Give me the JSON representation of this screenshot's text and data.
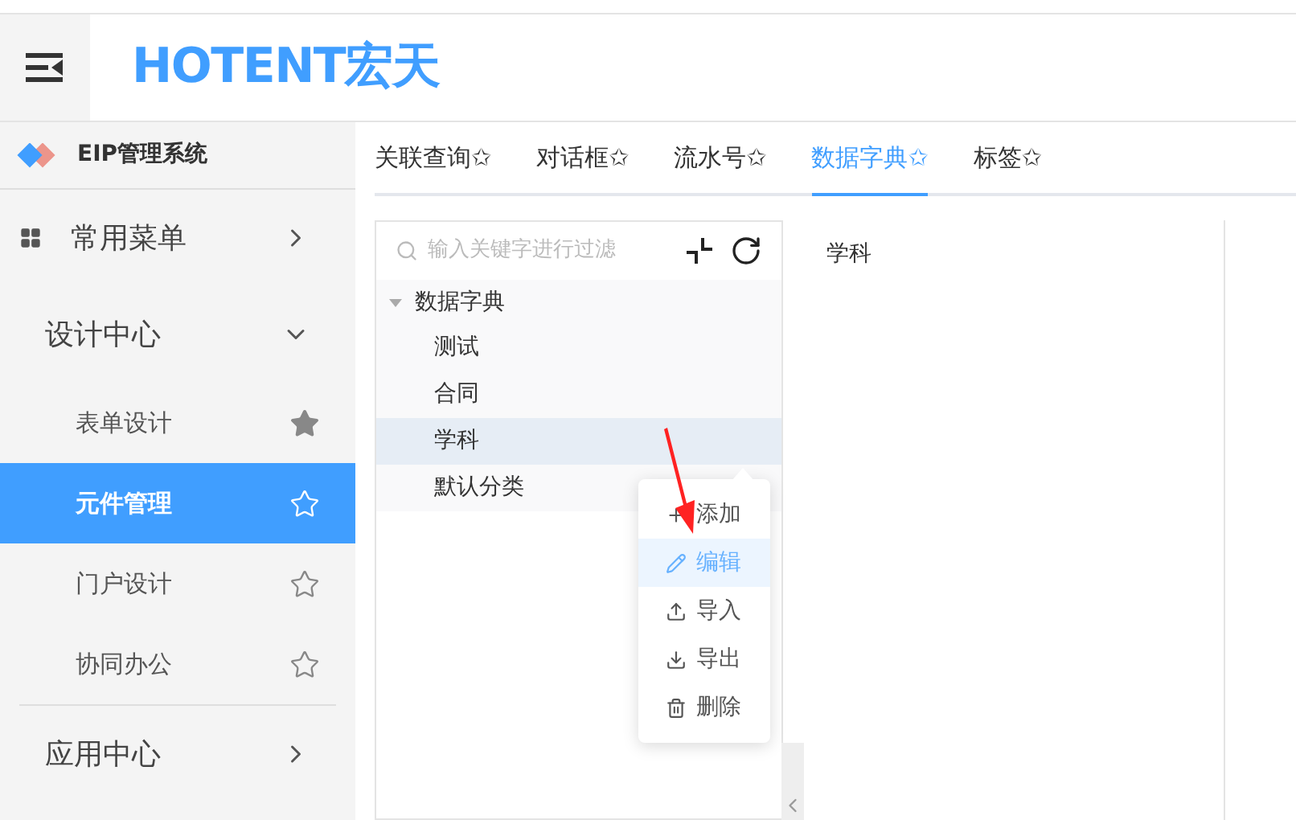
{
  "header": {
    "logo": "HOTENT宏天"
  },
  "sidebar": {
    "brand": "EIP管理系统",
    "menu": [
      {
        "label": "常用菜单",
        "expanded": false
      },
      {
        "label": "设计中心",
        "expanded": true,
        "children": [
          {
            "label": "表单设计",
            "selected": false,
            "starred": true
          },
          {
            "label": "元件管理",
            "selected": true,
            "starred": false
          },
          {
            "label": "门户设计",
            "selected": false,
            "starred": false
          },
          {
            "label": "协同办公",
            "selected": false,
            "starred": false
          }
        ]
      },
      {
        "label": "应用中心",
        "expanded": false
      }
    ]
  },
  "tabs": [
    {
      "label": "关联查询✩",
      "selected": false
    },
    {
      "label": "对话框✩",
      "selected": false
    },
    {
      "label": "流水号✩",
      "selected": false
    },
    {
      "label": "数据字典✩",
      "selected": true
    },
    {
      "label": "标签✩",
      "selected": false
    }
  ],
  "tree": {
    "search": {
      "placeholder": "输入关键字进行过滤"
    },
    "root": {
      "label": "数据字典",
      "expanded": true,
      "children": [
        {
          "label": "测试",
          "selected": false
        },
        {
          "label": "合同",
          "selected": false
        },
        {
          "label": "学科",
          "selected": true
        },
        {
          "label": "默认分类",
          "selected": false
        }
      ]
    }
  },
  "detail": {
    "title": "学科"
  },
  "context_menu": [
    {
      "label": "添加",
      "kind": "add",
      "highlighted": false
    },
    {
      "label": "编辑",
      "kind": "edit",
      "highlighted": true
    },
    {
      "label": "导入",
      "kind": "import",
      "highlighted": false
    },
    {
      "label": "导出",
      "kind": "export",
      "highlighted": false
    },
    {
      "label": "删除",
      "kind": "delete",
      "highlighted": false
    }
  ]
}
